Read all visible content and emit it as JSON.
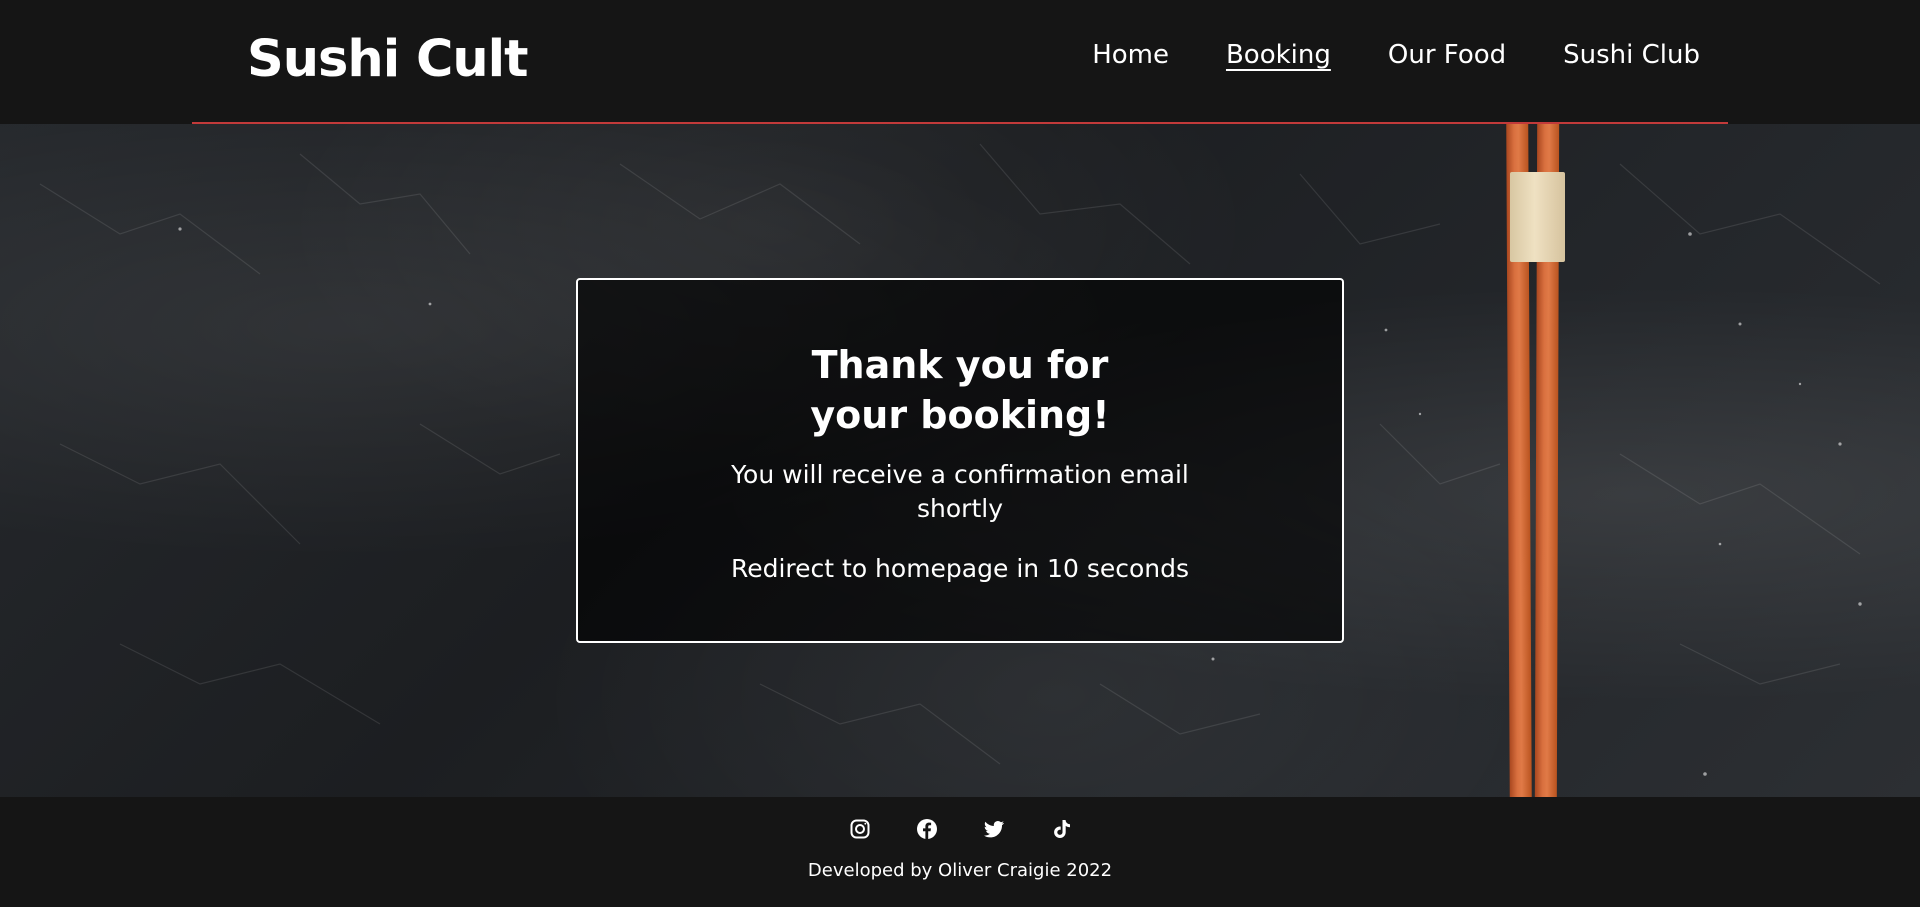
{
  "header": {
    "logo": "Sushi Cult",
    "nav": [
      {
        "label": "Home",
        "active": false
      },
      {
        "label": "Booking",
        "active": true
      },
      {
        "label": "Our Food",
        "active": false
      },
      {
        "label": "Sushi Club",
        "active": false
      }
    ],
    "accent_color": "#c23a3a"
  },
  "confirmation": {
    "title": "Thank you for your booking!",
    "message": "You will receive a confirmation email shortly",
    "redirect": "Redirect to homepage in 10 seconds",
    "redirect_seconds": 10
  },
  "footer": {
    "social": [
      {
        "icon": "instagram-icon"
      },
      {
        "icon": "facebook-icon"
      },
      {
        "icon": "twitter-icon"
      },
      {
        "icon": "tiktok-icon"
      }
    ],
    "credit": "Developed by Oliver Craigie 2022"
  },
  "colors": {
    "background": "#151515",
    "text": "#ffffff",
    "chopsticks": "#d9703f"
  }
}
